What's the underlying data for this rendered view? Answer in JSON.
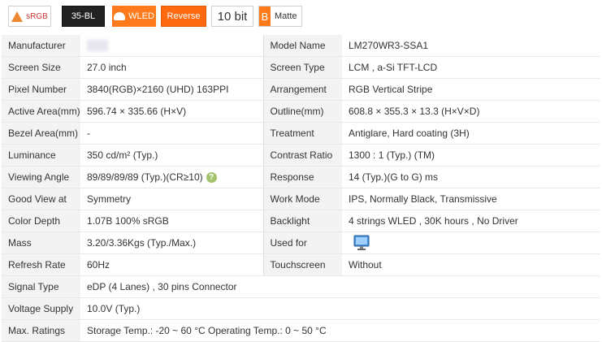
{
  "badges": {
    "srgb": "sRGB",
    "backlight": "35-BL",
    "wled": "WLED",
    "reverse": "Reverse",
    "bit": "10 bit",
    "matte": "Matte",
    "matte_letter": "B"
  },
  "specs": [
    {
      "l1": "Manufacturer",
      "v1": "",
      "l2": "Model Name",
      "v2": "LM270WR3-SSA1"
    },
    {
      "l1": "Screen Size",
      "v1": "27.0 inch",
      "l2": "Screen Type",
      "v2": "LCM ,   a-Si TFT-LCD"
    },
    {
      "l1": "Pixel Number",
      "v1": "3840(RGB)×2160   (UHD)  163PPI",
      "l2": "Arrangement",
      "v2": "RGB Vertical Stripe"
    },
    {
      "l1": "Active Area(mm)",
      "v1": "596.74 × 335.66 (H×V)",
      "l2": "Outline(mm)",
      "v2": "608.8 × 355.3 × 13.3 (H×V×D)"
    },
    {
      "l1": "Bezel Area(mm)",
      "v1": "-",
      "l2": "Treatment",
      "v2": "Antiglare, Hard coating (3H)"
    },
    {
      "l1": "Luminance",
      "v1": "350 cd/m² (Typ.)",
      "l2": "Contrast Ratio",
      "v2": "1300 : 1 (Typ.) (TM)"
    },
    {
      "l1": "Viewing Angle",
      "v1": "89/89/89/89 (Typ.)(CR≥10)",
      "l2": "Response",
      "v2": "14 (Typ.)(G to G) ms"
    },
    {
      "l1": "Good View at",
      "v1": "Symmetry",
      "l2": "Work Mode",
      "v2": "IPS, Normally Black, Transmissive"
    },
    {
      "l1": "Color Depth",
      "v1": "1.07B   100% sRGB",
      "l2": "Backlight",
      "v2": "4 strings WLED , 30K hours , No Driver"
    },
    {
      "l1": "Mass",
      "v1": "3.20/3.36Kgs (Typ./Max.)",
      "l2": "Used for",
      "v2": ""
    },
    {
      "l1": "Refresh Rate",
      "v1": "60Hz",
      "l2": "Touchscreen",
      "v2": "Without"
    }
  ],
  "full_rows": [
    {
      "l": "Signal Type",
      "v": "eDP (4 Lanes) , 30 pins Connector"
    },
    {
      "l": "Voltage Supply",
      "v": "10.0V (Typ.)"
    },
    {
      "l": "Max. Ratings",
      "v": "Storage Temp.: -20 ~ 60 °C    Operating Temp.: 0 ~ 50 °C"
    }
  ],
  "help_symbol": "?"
}
